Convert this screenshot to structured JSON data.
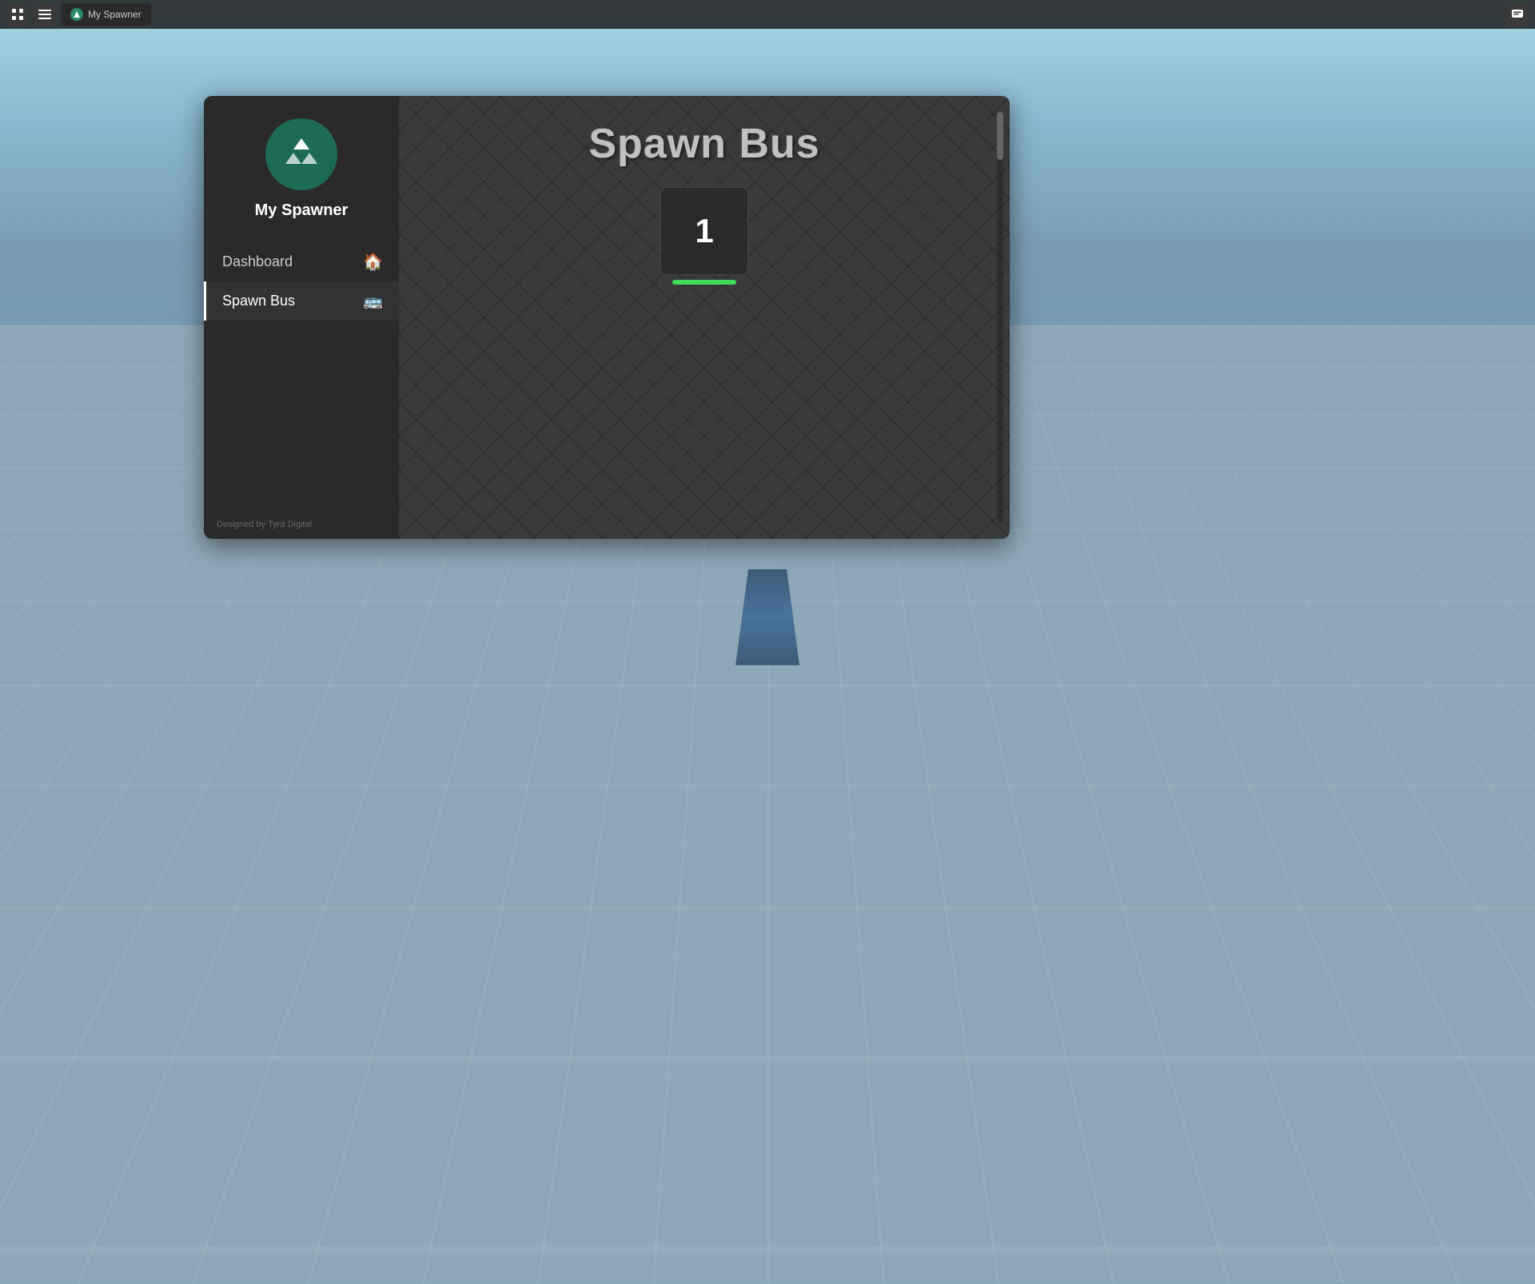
{
  "topbar": {
    "btn1_icon": "⊞",
    "btn2_icon": "☰",
    "tab_label": "My Spawner",
    "chat_icon": "💬"
  },
  "sidebar": {
    "logo_alt": "My Spawner Logo",
    "title": "My Spawner",
    "nav_items": [
      {
        "label": "Dashboard",
        "icon": "🏠",
        "active": false
      },
      {
        "label": "Spawn Bus",
        "icon": "🚌",
        "active": true
      }
    ],
    "footer": "Designed by Tyra Digital"
  },
  "main": {
    "page_title": "Spawn Bus",
    "bus_number": "1",
    "bar_color": "#3ddd5a"
  }
}
